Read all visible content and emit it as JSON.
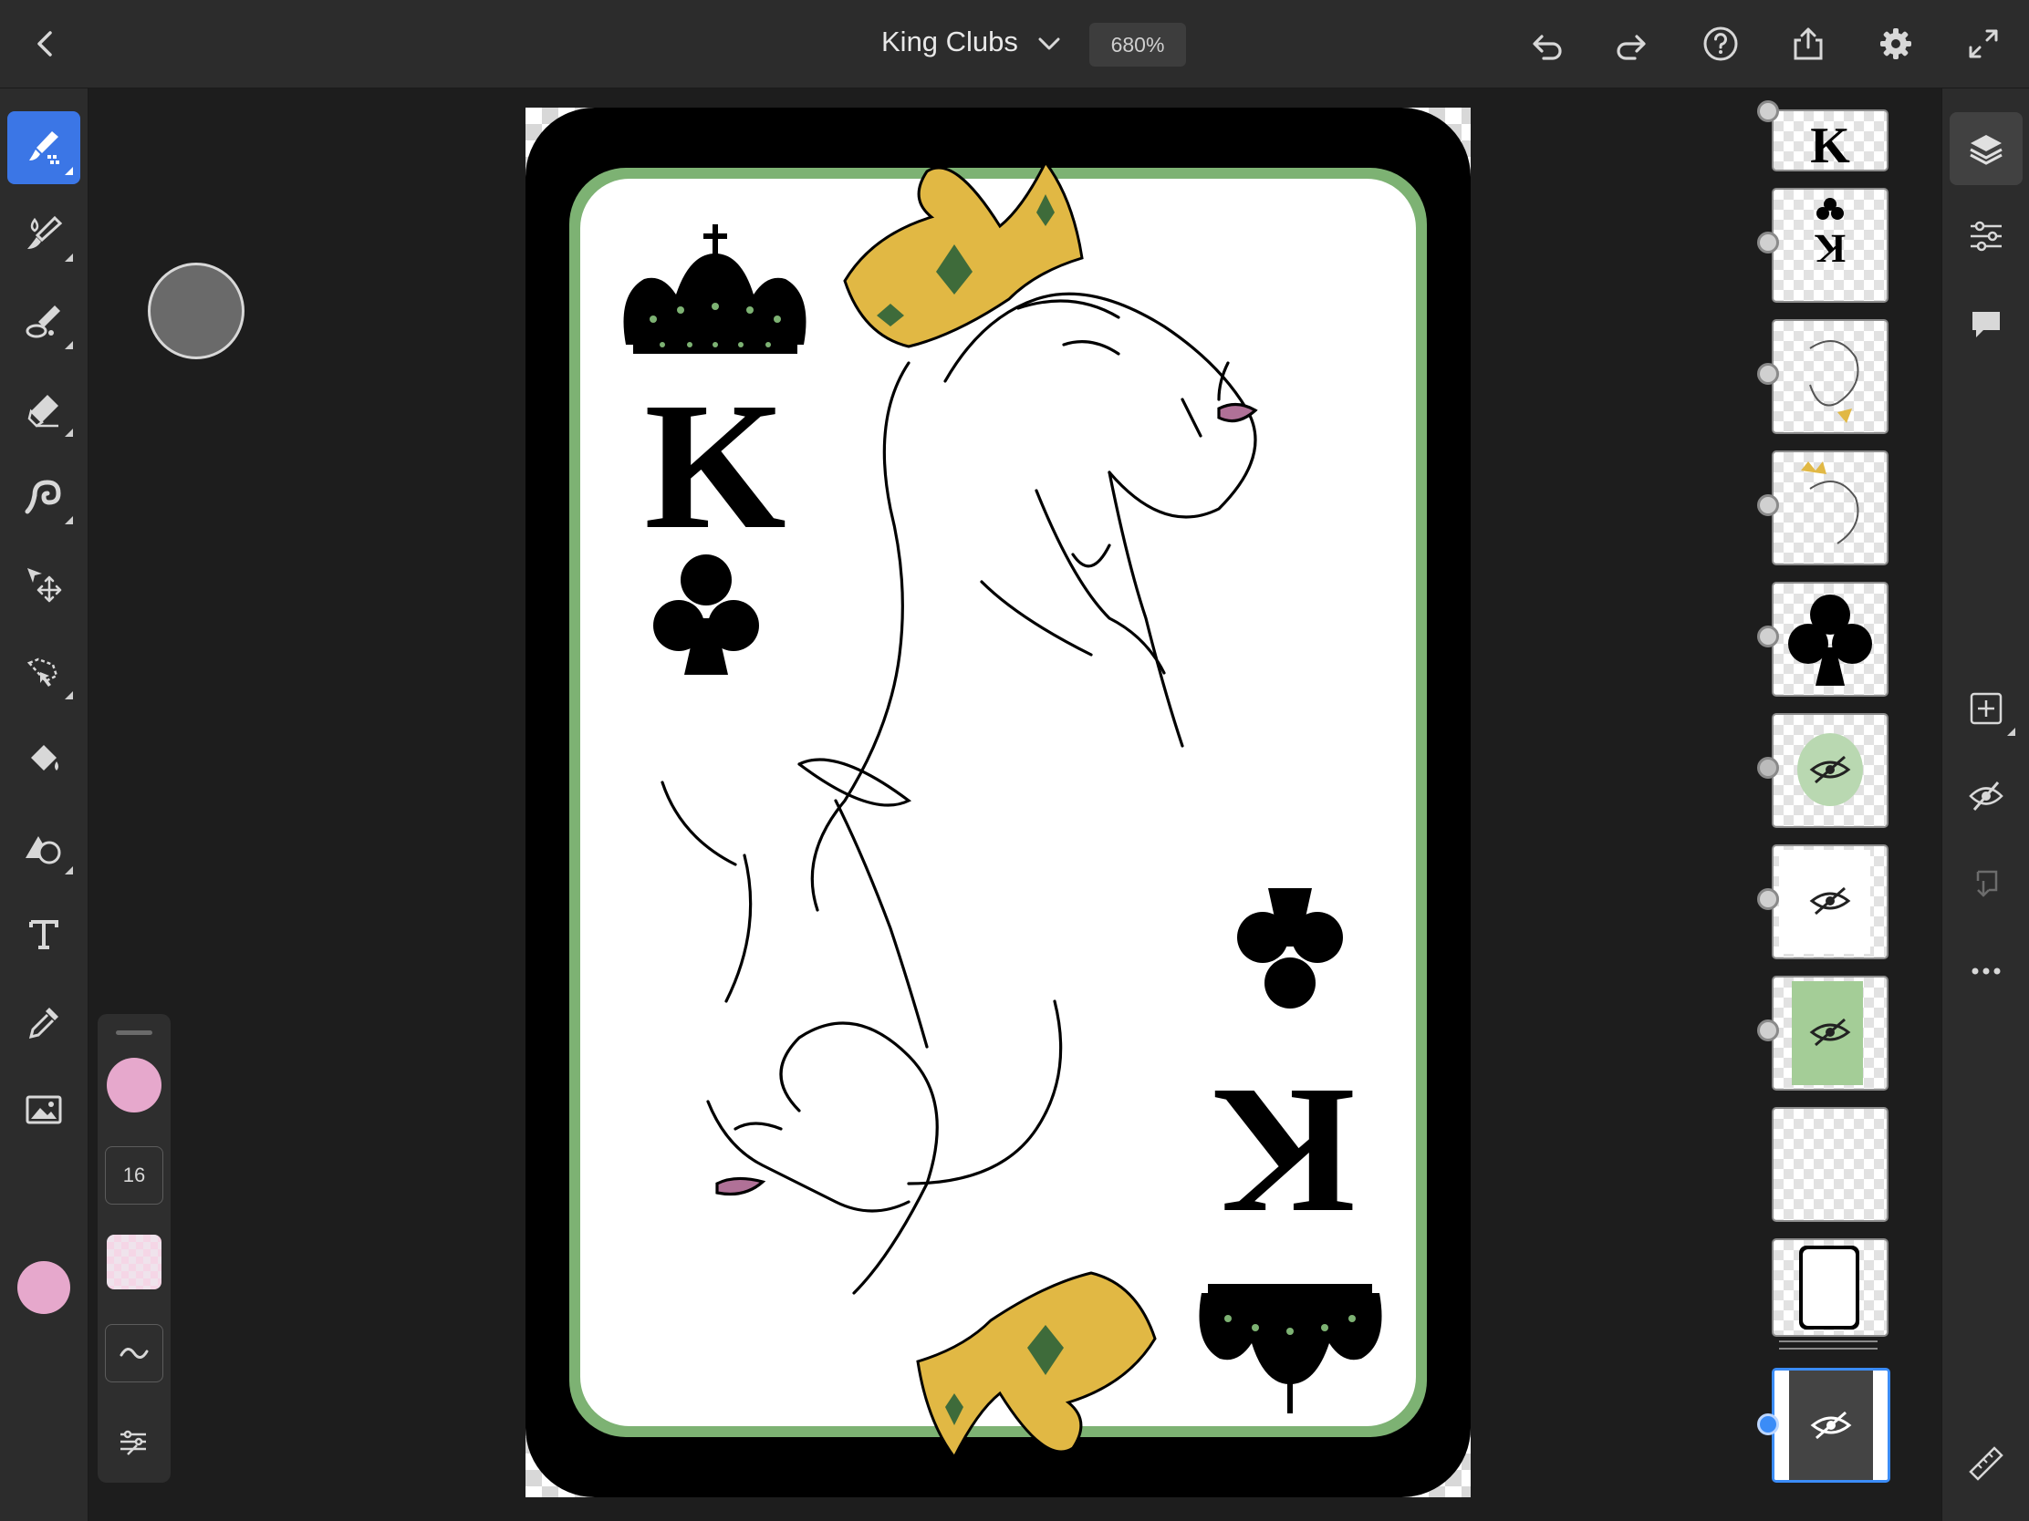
{
  "document": {
    "title": "King Clubs",
    "zoom": "680%"
  },
  "colors": {
    "primary": "#e6a8cc",
    "accent": "#3b76e6",
    "card_border": "#7db273",
    "crown_gold": "#e1b844",
    "lips": "#b07197"
  },
  "left_toolbar": {
    "tools": [
      {
        "name": "paint-tool-icon",
        "active": true
      },
      {
        "name": "brush-icon"
      },
      {
        "name": "smudge-icon"
      },
      {
        "name": "eraser-icon"
      },
      {
        "name": "liquify-icon"
      },
      {
        "name": "transform-move-icon"
      },
      {
        "name": "lasso-selection-icon"
      },
      {
        "name": "fill-bucket-icon"
      },
      {
        "name": "shape-icon"
      },
      {
        "name": "text-icon"
      },
      {
        "name": "eyedropper-icon"
      },
      {
        "name": "image-place-icon"
      }
    ]
  },
  "brush_panel": {
    "size": "16",
    "opacity_icon": "opacity-swatch",
    "smoothing_icon": "wave-icon",
    "settings_icon": "sliders-icon"
  },
  "layers": [
    {
      "name": "K letter top"
    },
    {
      "name": "club and K flipped"
    },
    {
      "name": "face sketch flipped with crown"
    },
    {
      "name": "face sketch with crown"
    },
    {
      "name": "club symbol"
    },
    {
      "name": "watercolor green",
      "hidden": true
    },
    {
      "name": "white card",
      "hidden": true
    },
    {
      "name": "green fill",
      "hidden": true
    },
    {
      "name": "empty layer"
    },
    {
      "name": "card frame"
    },
    {
      "name": "dark background",
      "hidden": true,
      "selected": true
    }
  ],
  "right_strip": {
    "buttons": [
      "layers-icon",
      "adjustments-icon",
      "comments-icon",
      "add-layer-icon",
      "hide-layer-icon",
      "merge-down-icon",
      "more-icon",
      "ruler-icon"
    ]
  }
}
